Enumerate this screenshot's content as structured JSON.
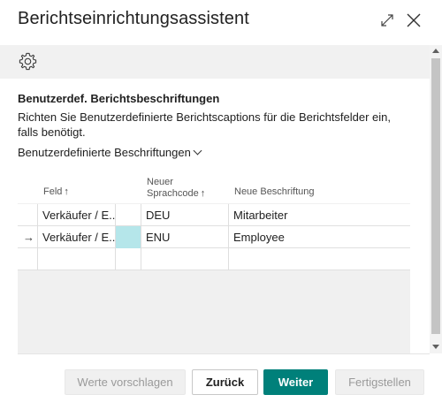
{
  "dialog": {
    "title": "Berichtseinrichtungsassistent"
  },
  "toolbar": {
    "settings_icon": "gear-icon"
  },
  "section": {
    "title": "Benutzerdef. Berichtsbeschriftungen",
    "description": "Richten Sie Benutzerdefinierte Berichtscaptions für die Berichtsfelder ein, falls benötigt.",
    "dropdown_label": "Benutzerdefinierte Beschriftungen"
  },
  "grid": {
    "columns": {
      "field": "Feld",
      "field_sort": "↑",
      "new_lang_line1": "Neuer",
      "new_lang_line2": "Sprachcode",
      "new_lang_sort": "↑",
      "new_caption": "Neue Beschriftung"
    },
    "rows": [
      {
        "marker": "",
        "field": "Verkäufer / E...",
        "lang": "DEU",
        "caption": "Mitarbeiter"
      },
      {
        "marker": "→",
        "field": "Verkäufer / E...",
        "lang": "ENU",
        "caption": "Employee"
      },
      {
        "marker": "",
        "field": "",
        "lang": "",
        "caption": ""
      }
    ]
  },
  "buttons": {
    "suggest": "Werte vorschlagen",
    "back": "Zurück",
    "next": "Weiter",
    "finish": "Fertigstellen"
  },
  "colors": {
    "accent": "#00807a",
    "selected_cell": "#b5e6ea"
  }
}
